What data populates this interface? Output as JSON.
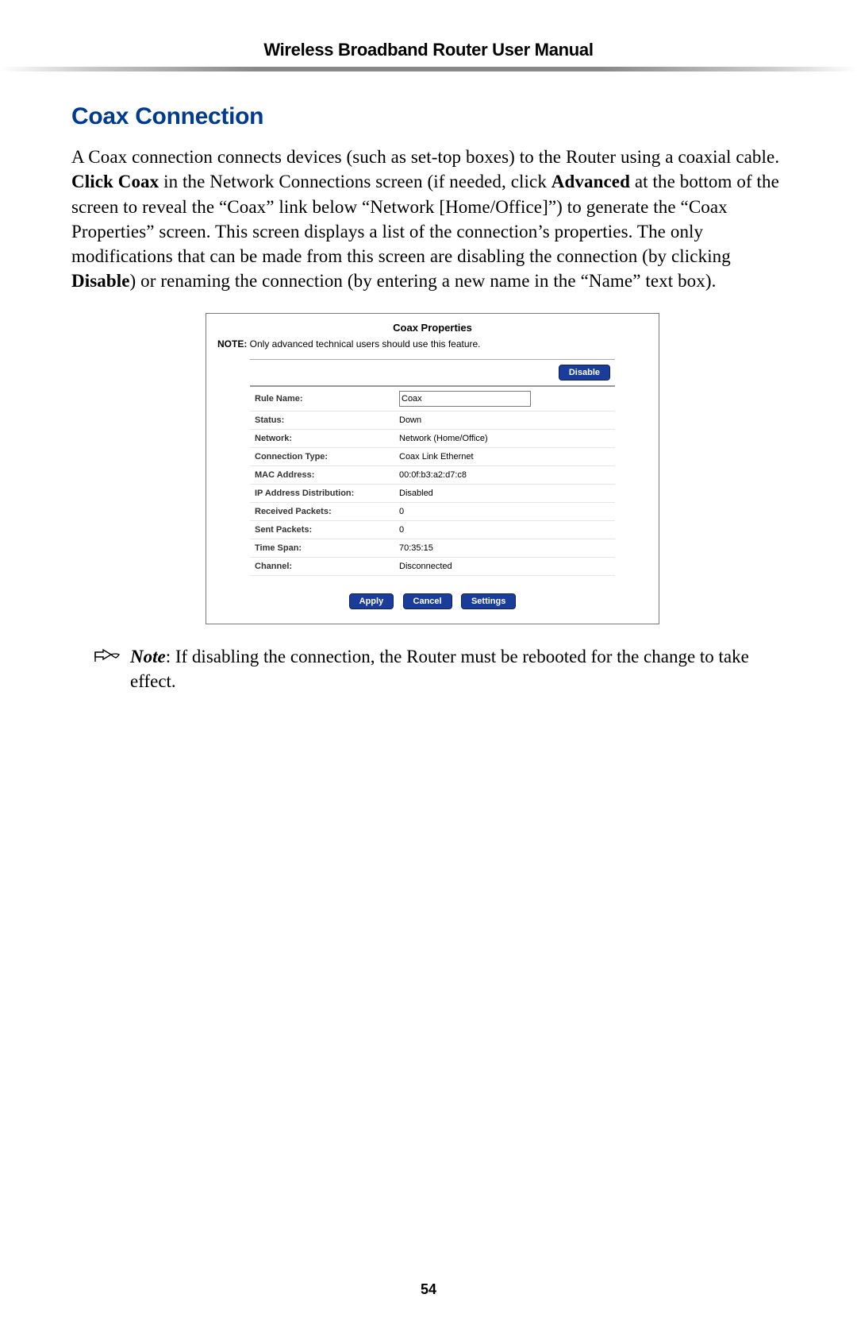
{
  "header": {
    "title": "Wireless Broadband Router User Manual"
  },
  "section": {
    "heading": "Coax Connection",
    "para_seg1": "A Coax connection connects devices (such as set-top boxes) to the Router using a coaxial cable. ",
    "para_click": "Click Coax",
    "para_seg2": " in the Network Connections screen (if needed, click ",
    "para_adv": "Advanced",
    "para_seg3": " at the bottom of the screen to reveal the “Coax” link below “Network [Home/Office]”) to generate the “Coax Properties” screen. This screen displays a list of the connection’s properties. The only modifications that can be made from this screen are disabling the connection (by clicking ",
    "para_disable": "Disable",
    "para_seg4": ") or renaming the connection (by entering a new name in the “Name” text box)."
  },
  "screenshot": {
    "title": "Coax Properties",
    "note_prefix": "NOTE:",
    "note_text": " Only advanced technical users should use this feature.",
    "disable_btn": "Disable",
    "name_input_value": "Coax",
    "rows": {
      "rule_name_label": "Rule Name:",
      "status_label": "Status:",
      "status_value": "Down",
      "network_label": "Network:",
      "network_value": "Network (Home/Office)",
      "conn_type_label": "Connection Type:",
      "conn_type_value": "Coax Link Ethernet",
      "mac_label": "MAC Address:",
      "mac_value": "00:0f:b3:a2:d7:c8",
      "ipdist_label": "IP Address Distribution:",
      "ipdist_value": "Disabled",
      "recv_label": "Received Packets:",
      "recv_value": "0",
      "sent_label": "Sent Packets:",
      "sent_value": "0",
      "time_label": "Time Span:",
      "time_value": "70:35:15",
      "channel_label": "Channel:",
      "channel_value": "Disconnected"
    },
    "buttons": {
      "apply": "Apply",
      "cancel": "Cancel",
      "settings": "Settings"
    }
  },
  "note": {
    "label": "Note",
    "text": ": If disabling the connection, the Router must be rebooted for the change to take effect."
  },
  "page_number": "54"
}
